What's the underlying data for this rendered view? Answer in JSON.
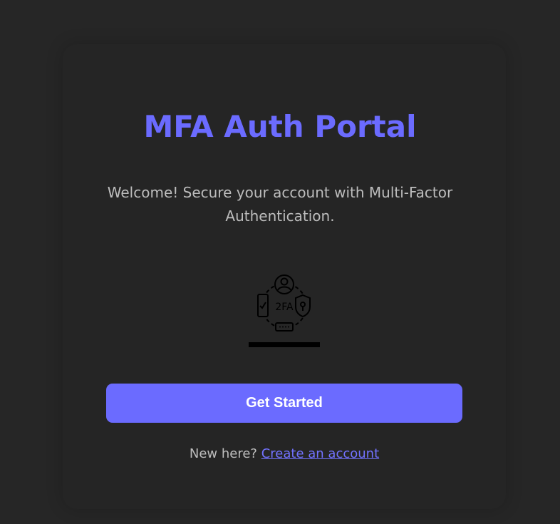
{
  "header": {
    "title": "MFA Auth Portal"
  },
  "main": {
    "welcome_text": "Welcome! Secure your account with Multi-Factor Authentication.",
    "illustration": {
      "icon": "two-factor-auth-icon",
      "label": "2FA"
    },
    "primary_button": {
      "label": "Get Started"
    },
    "signup": {
      "prompt": "New here?",
      "link_label": "Create an account"
    }
  },
  "colors": {
    "background": "#262626",
    "accent": "#6b6bff",
    "text_muted": "#bdbdbd",
    "button_text": "#ffffff"
  }
}
